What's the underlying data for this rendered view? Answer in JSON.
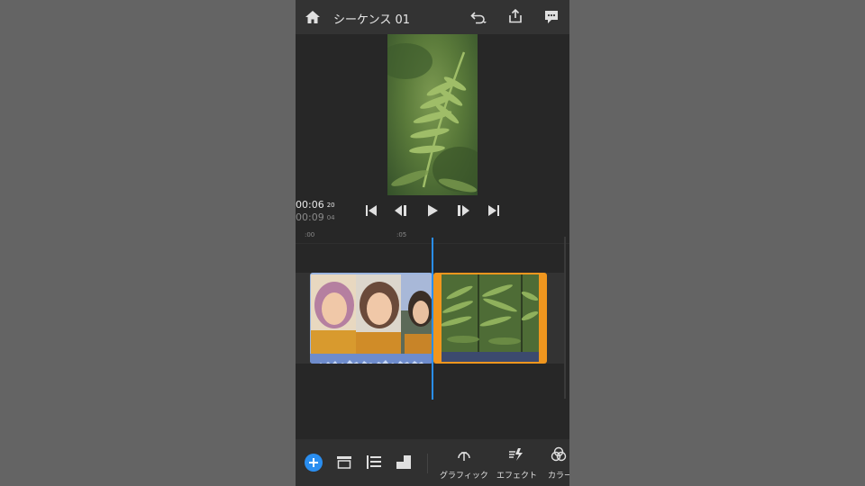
{
  "header": {
    "title": "シーケンス 01",
    "icons": [
      "home-icon",
      "undo-icon",
      "share-icon",
      "comment-icon"
    ]
  },
  "player": {
    "current_time": "00:06",
    "current_frames": "20",
    "total_time": "00:09",
    "total_frames": "04",
    "controls": [
      "skip-to-start-icon",
      "step-back-icon",
      "play-icon",
      "step-forward-icon",
      "skip-to-end-icon"
    ]
  },
  "timeline": {
    "ruler_marks": [
      ":00",
      ":05"
    ],
    "clips": [
      {
        "name": "portrait-clip",
        "selected": false
      },
      {
        "name": "fern-clip",
        "selected": true
      }
    ]
  },
  "toolbar": {
    "tools": [
      {
        "icon": "add-icon"
      },
      {
        "icon": "timeline-view-icon"
      },
      {
        "icon": "track-align-icon"
      },
      {
        "icon": "crop-icon"
      },
      {
        "icon": "graphics-icon",
        "label": "グラフィック"
      },
      {
        "icon": "effects-icon",
        "label": "エフェクト"
      },
      {
        "icon": "color-icon",
        "label": "カラー"
      }
    ]
  },
  "colors": {
    "accent_blue": "#2a8ef0",
    "selection_orange": "#f0961e",
    "clip_blue": "#9bb5e0"
  }
}
